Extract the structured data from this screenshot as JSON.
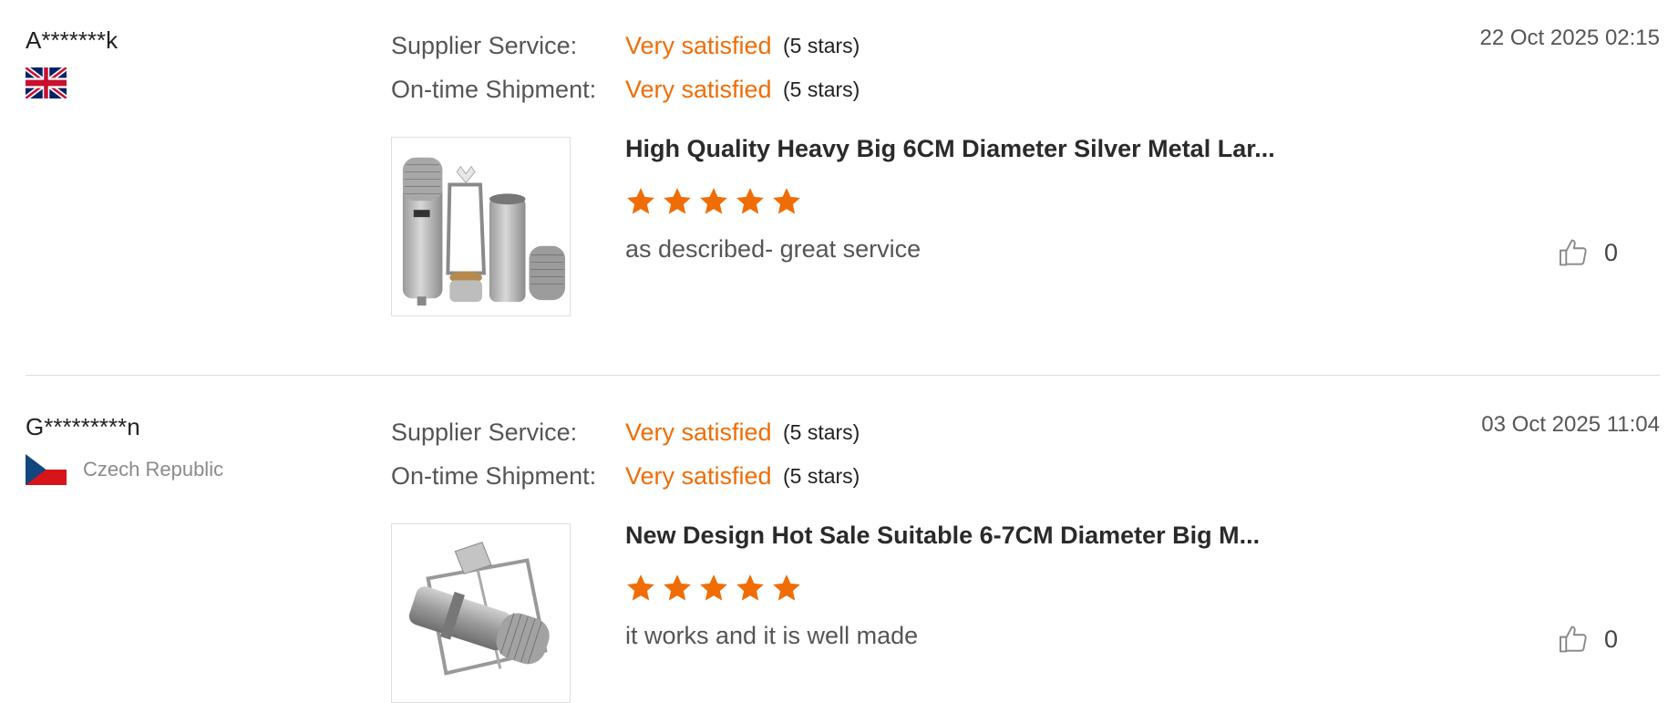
{
  "reviews": [
    {
      "buyer": "A*******k",
      "country": "",
      "flag_icon": "uk-flag-icon",
      "date": "22 Oct 2025 02:15",
      "supplier_service_label": "Supplier Service:",
      "supplier_service_value": "Very satisfied",
      "supplier_service_stars": "(5 stars)",
      "shipment_label": "On-time Shipment:",
      "shipment_value": "Very satisfied",
      "shipment_stars": "(5 stars)",
      "product_title": "High Quality Heavy Big 6CM Diameter Silver Metal Lar...",
      "rating": 5,
      "comment": "as described- great service",
      "likes": "0"
    },
    {
      "buyer": "G*********n",
      "country": "Czech Republic",
      "flag_icon": "czech-flag-icon",
      "date": "03 Oct 2025 11:04",
      "supplier_service_label": "Supplier Service:",
      "supplier_service_value": "Very satisfied",
      "supplier_service_stars": "(5 stars)",
      "shipment_label": "On-time Shipment:",
      "shipment_value": "Very satisfied",
      "shipment_stars": "(5 stars)",
      "product_title": "New Design Hot Sale Suitable 6-7CM Diameter Big M...",
      "rating": 5,
      "comment": "it works and it is well made",
      "likes": "0"
    }
  ],
  "colors": {
    "accent": "#f06d06",
    "star": "#f06d06",
    "divider": "#dcdcdc"
  }
}
